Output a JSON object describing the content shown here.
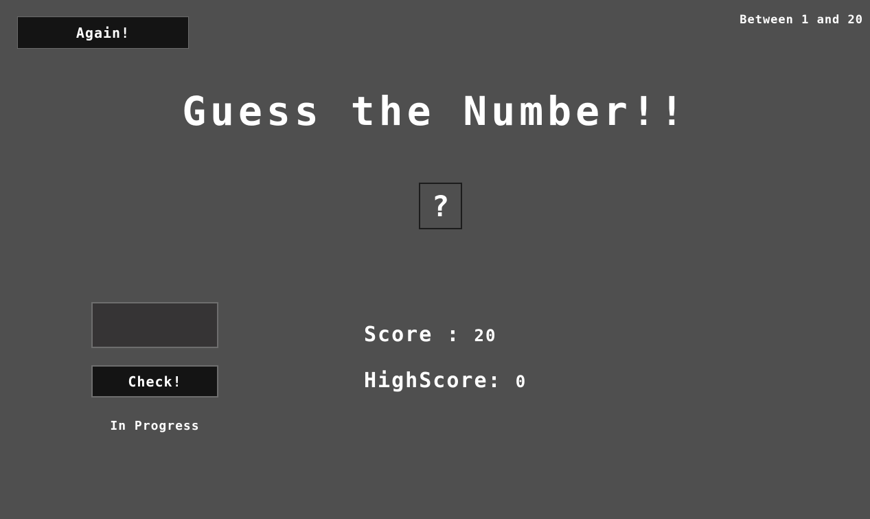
{
  "header": {
    "again_label": "Again!",
    "range_text": "Between 1 and 20"
  },
  "main": {
    "title": "Guess the Number!!",
    "secret_display": "?"
  },
  "controls": {
    "guess_value": "",
    "guess_placeholder": "",
    "check_label": "Check!",
    "status_message": "In Progress"
  },
  "stats": {
    "score_label": "Score : ",
    "score_value": "20",
    "highscore_label": "HighScore: ",
    "highscore_value": "0"
  },
  "colors": {
    "background": "#4f4f4f",
    "button_bg": "#141414",
    "input_bg": "#363435",
    "text": "#ffffff"
  }
}
